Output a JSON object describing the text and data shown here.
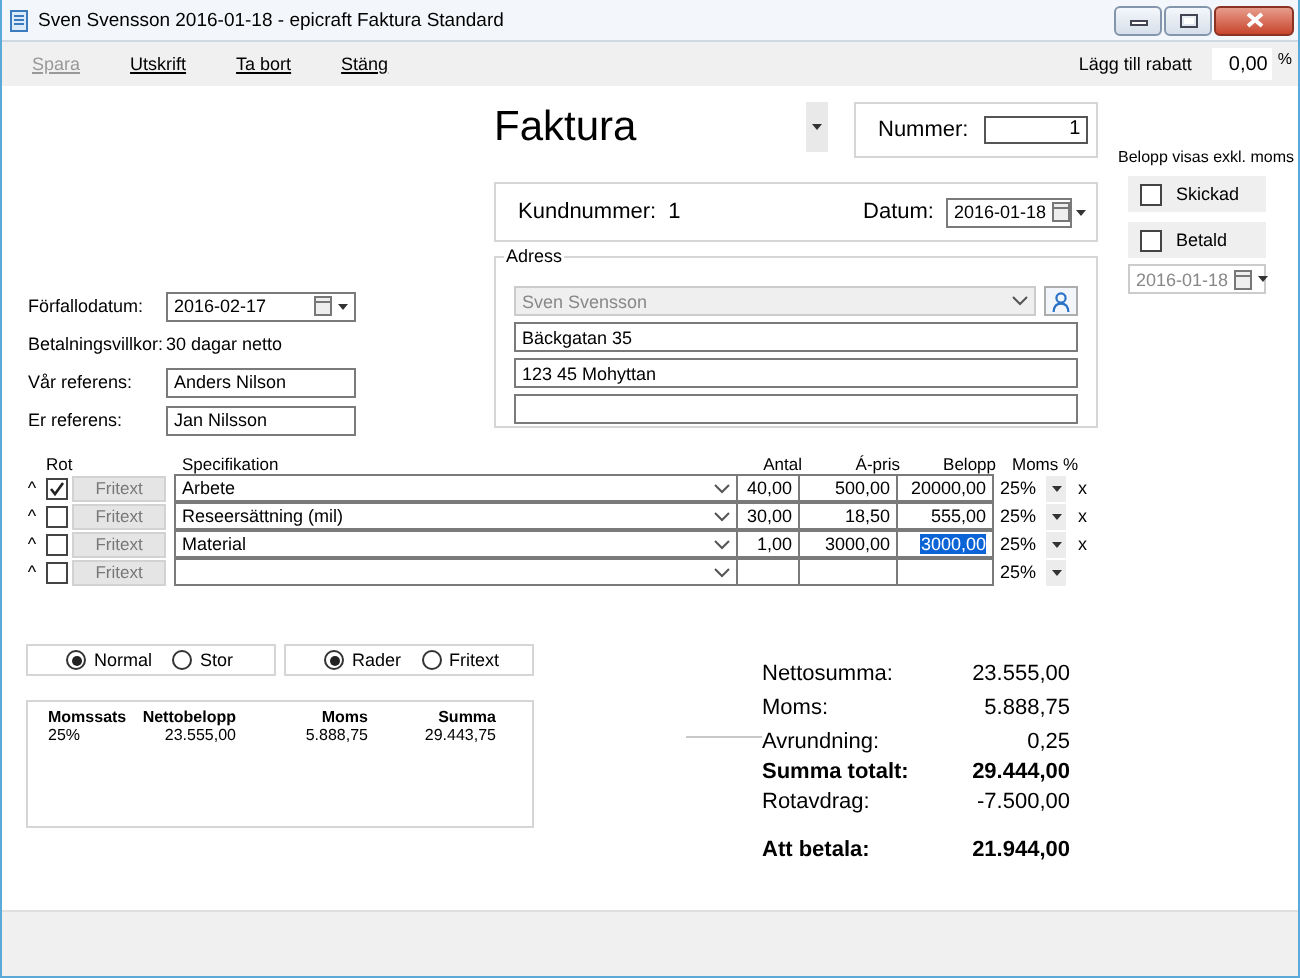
{
  "window": {
    "title": "Sven Svensson 2016-01-18 - epicraft Faktura Standard"
  },
  "toolbar": {
    "buttons": [
      {
        "label": "Spara",
        "disabled": true
      },
      {
        "label": "Utskrift",
        "disabled": false
      },
      {
        "label": "Ta bort",
        "disabled": false
      },
      {
        "label": "Stäng",
        "disabled": false
      }
    ],
    "discount_label": "Lägg till rabatt",
    "discount_value": "0,00",
    "discount_unit": "%"
  },
  "header": {
    "title": "Faktura",
    "number_label": "Nummer:",
    "number": "1",
    "customer_label": "Kundnummer:",
    "customer_number": "1",
    "date_label": "Datum:",
    "date": "2016-01-18"
  },
  "status": {
    "note": "Belopp visas exkl. moms",
    "flags": [
      {
        "label": "Skickad",
        "checked": false
      },
      {
        "label": "Betald",
        "checked": false
      }
    ],
    "paid_date": "2016-01-18"
  },
  "terms": [
    {
      "label": "Förfallodatum:",
      "value": "2016-02-17",
      "kind": "date"
    },
    {
      "label": "Betalningsvillkor:",
      "value": "30 dagar netto",
      "kind": "text"
    },
    {
      "label": "Vår referens:",
      "value": "Anders Nilson",
      "kind": "field"
    },
    {
      "label": "Er referens:",
      "value": "Jan Nilsson",
      "kind": "field"
    }
  ],
  "address": {
    "legend": "Adress",
    "name": "Sven Svensson",
    "name_disabled": true,
    "lines": [
      "Bäckgatan 35",
      "123 45 Mohyttan"
    ]
  },
  "lines": {
    "columns": [
      "Rot",
      "Specifikation",
      "Antal",
      "Á-pris",
      "Belopp",
      "Moms %"
    ],
    "rows": [
      {
        "move": "^",
        "rot": true,
        "button": "Fritext",
        "spec": "Arbete",
        "qty": "40,00",
        "price": "500,00",
        "amount": "20000,00",
        "amount_selected": false,
        "vat": "25%",
        "remove": "x"
      },
      {
        "move": "^",
        "rot": false,
        "button": "Fritext",
        "spec": "Reseersättning (mil)",
        "qty": "30,00",
        "price": "18,50",
        "amount": "555,00",
        "amount_selected": false,
        "vat": "25%",
        "remove": "x"
      },
      {
        "move": "^",
        "rot": false,
        "button": "Fritext",
        "spec": "Material",
        "qty": "1,00",
        "price": "3000,00",
        "amount": "3000,00",
        "amount_selected": true,
        "vat": "25%",
        "remove": "x"
      },
      {
        "move": "^",
        "rot": false,
        "button": "Fritext",
        "vat": "25%"
      }
    ]
  },
  "view_options": [
    {
      "options": [
        {
          "label": "Normal",
          "selected": true
        },
        {
          "label": "Stor",
          "selected": false
        }
      ]
    },
    {
      "options": [
        {
          "label": "Rader",
          "selected": true
        },
        {
          "label": "Fritext",
          "selected": false
        }
      ]
    }
  ],
  "vat_summary": {
    "columns": [
      "Momssats",
      "Nettobelopp",
      "Moms",
      "Summa"
    ],
    "rows": [
      [
        "25%",
        "23.555,00",
        "5.888,75",
        "29.443,75"
      ]
    ]
  },
  "totals": [
    {
      "label": "Nettosumma:",
      "value": "23.555,00",
      "kind": "line"
    },
    {
      "label": "Moms:",
      "value": "5.888,75",
      "kind": "line"
    },
    {
      "label": "Avrundning:",
      "value": "0,25",
      "kind": "line"
    },
    {
      "label": "Summa totalt:",
      "value": "29.444,00",
      "kind": "total"
    },
    {
      "label": "Rotavdrag:",
      "value": "-7.500,00",
      "kind": "line"
    },
    {
      "label": "Att betala:",
      "value": "21.944,00",
      "kind": "final"
    }
  ]
}
